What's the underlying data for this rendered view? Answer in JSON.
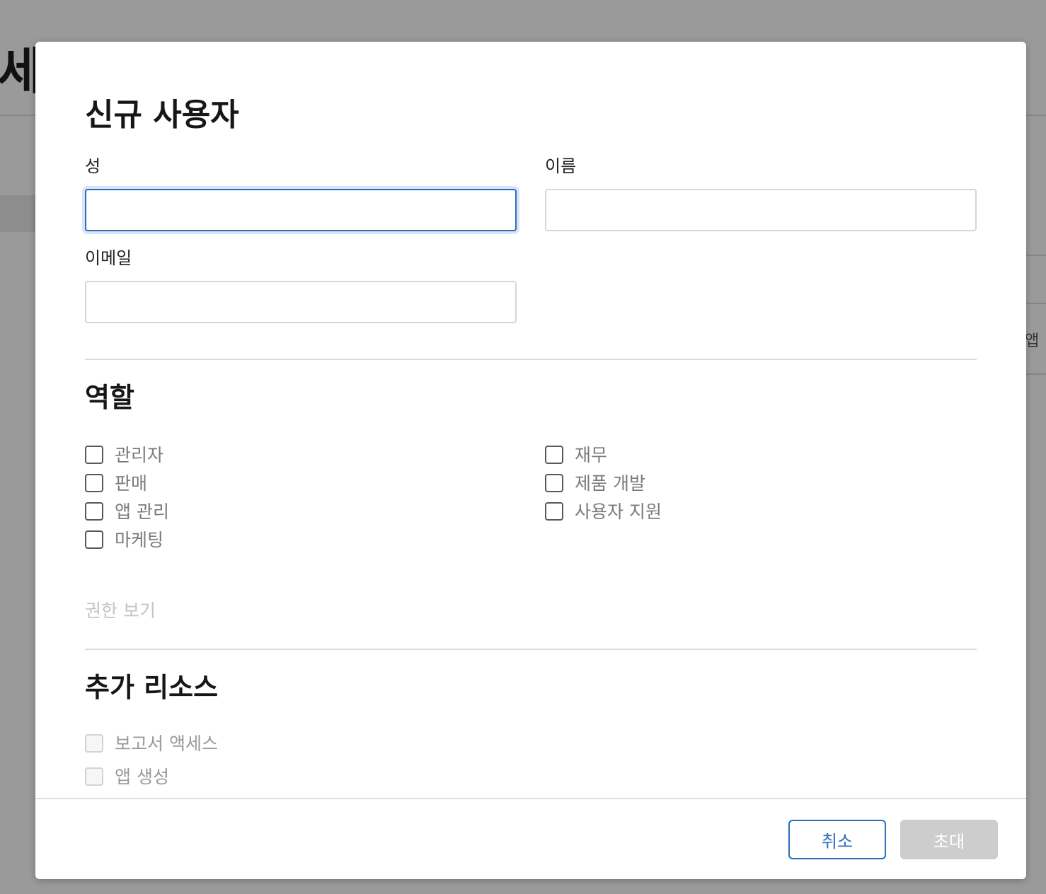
{
  "background": {
    "title_fragment": "세스",
    "side_fragment": "앱"
  },
  "dialog": {
    "title": "신규 사용자",
    "fields": {
      "last_name": {
        "label": "성",
        "value": ""
      },
      "first_name": {
        "label": "이름",
        "value": ""
      },
      "email": {
        "label": "이메일",
        "value": ""
      }
    },
    "roles": {
      "heading": "역할",
      "left": [
        "관리자",
        "판매",
        "앱 관리",
        "마케팅"
      ],
      "right": [
        "재무",
        "제품 개발",
        "사용자 지원"
      ]
    },
    "view_permissions_link": "권한 보기",
    "additional_resources": {
      "heading": "추가 리소스",
      "items": [
        "보고서 액세스",
        "앱 생성"
      ]
    },
    "buttons": {
      "cancel": "취소",
      "invite": "초대"
    }
  },
  "colors": {
    "accent": "#2a6ebb",
    "overlay": "#9a9a9a",
    "disabled_button": "#cdcdcd"
  }
}
